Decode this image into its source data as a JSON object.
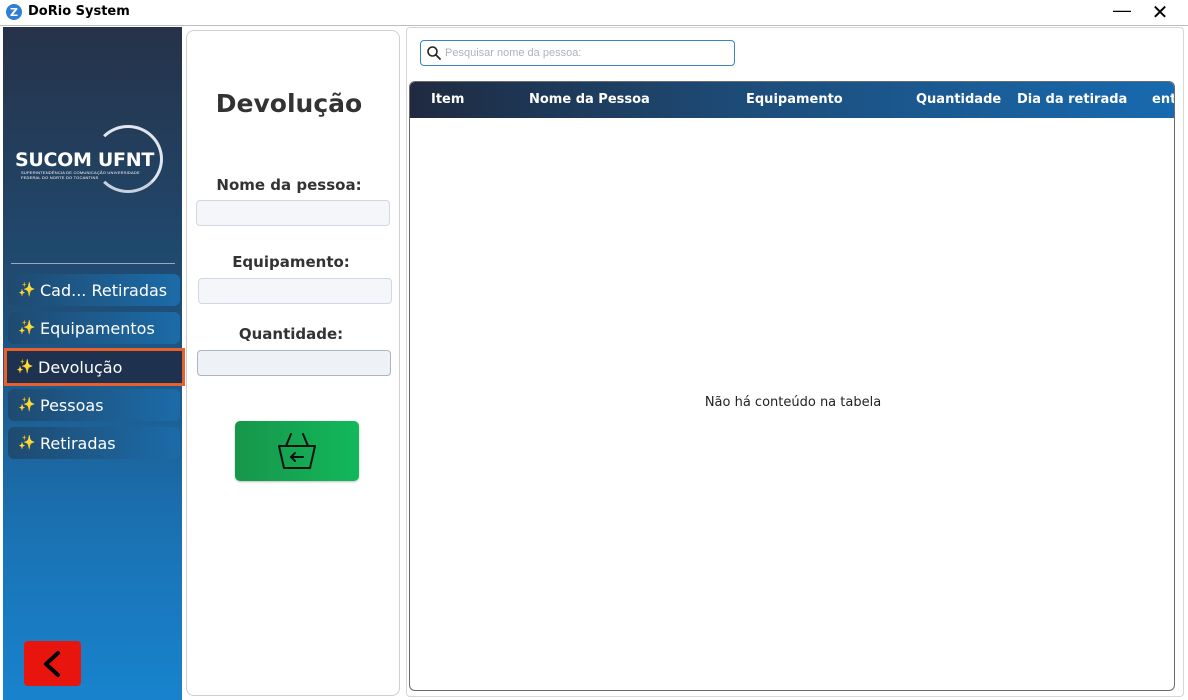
{
  "window": {
    "title": "DoRio System",
    "logo_letter": "Z",
    "minimize_glyph": "—",
    "close_glyph": "✕"
  },
  "sidebar": {
    "brand": {
      "name": "SUCOM UFNT",
      "subtitle": "SUPERINTENDÊNCIA DE COMUNICAÇÃO UNIVERSIDADE FEDERAL DO NORTE DO TOCANTINS"
    },
    "items": [
      {
        "label": "Cad... Retiradas",
        "icon": "sparkle-wand-icon"
      },
      {
        "label": "Equipamentos",
        "icon": "sparkle-wand-icon"
      },
      {
        "label": "Devolução",
        "icon": "sparkle-wand-icon",
        "active": true
      },
      {
        "label": "Pessoas",
        "icon": "sparkle-wand-icon"
      },
      {
        "label": "Retiradas",
        "icon": "sparkle-wand-icon"
      }
    ],
    "back_button_icon": "chevron-left-icon",
    "colors": {
      "back_button": "#e8150e",
      "active_outline": "#e8602c"
    }
  },
  "form": {
    "title": "Devolução",
    "fields": [
      {
        "label": "Nome da pessoa:",
        "value": ""
      },
      {
        "label": "Equipamento:",
        "value": ""
      },
      {
        "label": "Quantidade:",
        "value": ""
      }
    ],
    "submit_icon": "basket-return-icon",
    "colors": {
      "submit": "#12b85b"
    }
  },
  "table": {
    "search_placeholder": "Pesquisar nome da pessoa:",
    "columns": [
      "Item",
      "Nome da Pessoa",
      "Equipamento",
      "Quantidade",
      "Dia da retirada",
      "entr"
    ],
    "rows": [],
    "empty_message": "Não há conteúdo na tabela"
  }
}
